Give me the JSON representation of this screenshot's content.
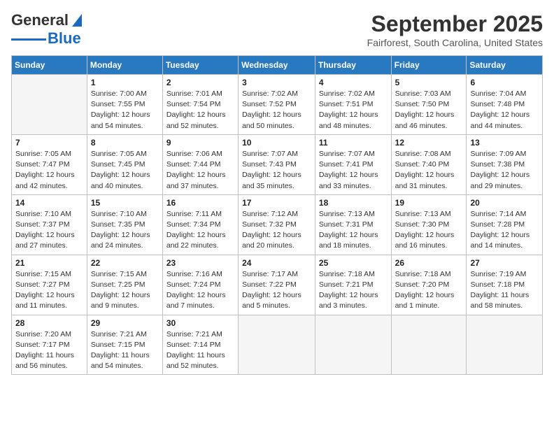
{
  "header": {
    "logo_general": "General",
    "logo_blue": "Blue",
    "month_title": "September 2025",
    "subtitle": "Fairforest, South Carolina, United States"
  },
  "days_of_week": [
    "Sunday",
    "Monday",
    "Tuesday",
    "Wednesday",
    "Thursday",
    "Friday",
    "Saturday"
  ],
  "weeks": [
    [
      {
        "day": "",
        "info": ""
      },
      {
        "day": "1",
        "info": "Sunrise: 7:00 AM\nSunset: 7:55 PM\nDaylight: 12 hours\nand 54 minutes."
      },
      {
        "day": "2",
        "info": "Sunrise: 7:01 AM\nSunset: 7:54 PM\nDaylight: 12 hours\nand 52 minutes."
      },
      {
        "day": "3",
        "info": "Sunrise: 7:02 AM\nSunset: 7:52 PM\nDaylight: 12 hours\nand 50 minutes."
      },
      {
        "day": "4",
        "info": "Sunrise: 7:02 AM\nSunset: 7:51 PM\nDaylight: 12 hours\nand 48 minutes."
      },
      {
        "day": "5",
        "info": "Sunrise: 7:03 AM\nSunset: 7:50 PM\nDaylight: 12 hours\nand 46 minutes."
      },
      {
        "day": "6",
        "info": "Sunrise: 7:04 AM\nSunset: 7:48 PM\nDaylight: 12 hours\nand 44 minutes."
      }
    ],
    [
      {
        "day": "7",
        "info": "Sunrise: 7:05 AM\nSunset: 7:47 PM\nDaylight: 12 hours\nand 42 minutes."
      },
      {
        "day": "8",
        "info": "Sunrise: 7:05 AM\nSunset: 7:45 PM\nDaylight: 12 hours\nand 40 minutes."
      },
      {
        "day": "9",
        "info": "Sunrise: 7:06 AM\nSunset: 7:44 PM\nDaylight: 12 hours\nand 37 minutes."
      },
      {
        "day": "10",
        "info": "Sunrise: 7:07 AM\nSunset: 7:43 PM\nDaylight: 12 hours\nand 35 minutes."
      },
      {
        "day": "11",
        "info": "Sunrise: 7:07 AM\nSunset: 7:41 PM\nDaylight: 12 hours\nand 33 minutes."
      },
      {
        "day": "12",
        "info": "Sunrise: 7:08 AM\nSunset: 7:40 PM\nDaylight: 12 hours\nand 31 minutes."
      },
      {
        "day": "13",
        "info": "Sunrise: 7:09 AM\nSunset: 7:38 PM\nDaylight: 12 hours\nand 29 minutes."
      }
    ],
    [
      {
        "day": "14",
        "info": "Sunrise: 7:10 AM\nSunset: 7:37 PM\nDaylight: 12 hours\nand 27 minutes."
      },
      {
        "day": "15",
        "info": "Sunrise: 7:10 AM\nSunset: 7:35 PM\nDaylight: 12 hours\nand 24 minutes."
      },
      {
        "day": "16",
        "info": "Sunrise: 7:11 AM\nSunset: 7:34 PM\nDaylight: 12 hours\nand 22 minutes."
      },
      {
        "day": "17",
        "info": "Sunrise: 7:12 AM\nSunset: 7:32 PM\nDaylight: 12 hours\nand 20 minutes."
      },
      {
        "day": "18",
        "info": "Sunrise: 7:13 AM\nSunset: 7:31 PM\nDaylight: 12 hours\nand 18 minutes."
      },
      {
        "day": "19",
        "info": "Sunrise: 7:13 AM\nSunset: 7:30 PM\nDaylight: 12 hours\nand 16 minutes."
      },
      {
        "day": "20",
        "info": "Sunrise: 7:14 AM\nSunset: 7:28 PM\nDaylight: 12 hours\nand 14 minutes."
      }
    ],
    [
      {
        "day": "21",
        "info": "Sunrise: 7:15 AM\nSunset: 7:27 PM\nDaylight: 12 hours\nand 11 minutes."
      },
      {
        "day": "22",
        "info": "Sunrise: 7:15 AM\nSunset: 7:25 PM\nDaylight: 12 hours\nand 9 minutes."
      },
      {
        "day": "23",
        "info": "Sunrise: 7:16 AM\nSunset: 7:24 PM\nDaylight: 12 hours\nand 7 minutes."
      },
      {
        "day": "24",
        "info": "Sunrise: 7:17 AM\nSunset: 7:22 PM\nDaylight: 12 hours\nand 5 minutes."
      },
      {
        "day": "25",
        "info": "Sunrise: 7:18 AM\nSunset: 7:21 PM\nDaylight: 12 hours\nand 3 minutes."
      },
      {
        "day": "26",
        "info": "Sunrise: 7:18 AM\nSunset: 7:20 PM\nDaylight: 12 hours\nand 1 minute."
      },
      {
        "day": "27",
        "info": "Sunrise: 7:19 AM\nSunset: 7:18 PM\nDaylight: 11 hours\nand 58 minutes."
      }
    ],
    [
      {
        "day": "28",
        "info": "Sunrise: 7:20 AM\nSunset: 7:17 PM\nDaylight: 11 hours\nand 56 minutes."
      },
      {
        "day": "29",
        "info": "Sunrise: 7:21 AM\nSunset: 7:15 PM\nDaylight: 11 hours\nand 54 minutes."
      },
      {
        "day": "30",
        "info": "Sunrise: 7:21 AM\nSunset: 7:14 PM\nDaylight: 11 hours\nand 52 minutes."
      },
      {
        "day": "",
        "info": ""
      },
      {
        "day": "",
        "info": ""
      },
      {
        "day": "",
        "info": ""
      },
      {
        "day": "",
        "info": ""
      }
    ]
  ]
}
